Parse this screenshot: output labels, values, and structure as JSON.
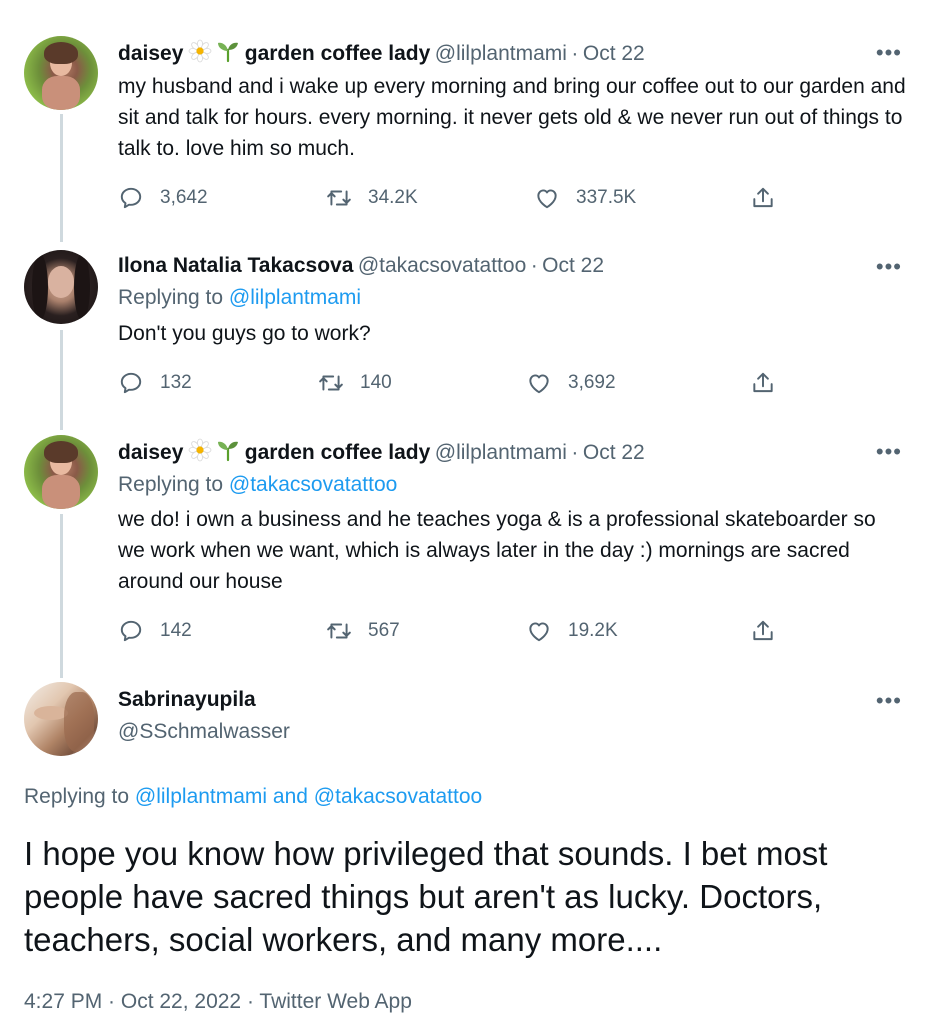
{
  "tweets": [
    {
      "display_name": "daisey",
      "name_suffix": "garden coffee lady",
      "handle": "@lilplantmami",
      "separator": "·",
      "date": "Oct 22",
      "text": "my husband and i wake up every morning and bring our coffee out to our garden and sit and talk for hours. every morning. it never gets old & we never run out of things to talk to. love him so much.",
      "replies": "3,642",
      "retweets": "34.2K",
      "likes": "337.5K"
    },
    {
      "display_name": "Ilona Natalia Takacsova",
      "handle": "@takacsovatattoo",
      "separator": "·",
      "date": "Oct 22",
      "replying_label": "Replying to",
      "replying_to": "@lilplantmami",
      "text": "Don't you guys go to work?",
      "replies": "132",
      "retweets": "140",
      "likes": "3,692"
    },
    {
      "display_name": "daisey",
      "name_suffix": "garden coffee lady",
      "handle": "@lilplantmami",
      "separator": "·",
      "date": "Oct 22",
      "replying_label": "Replying to",
      "replying_to": "@takacsovatattoo",
      "text": "we do! i own a business and he teaches yoga & is a professional skateboarder so we work when we want, which is always later in the day :) mornings are sacred around our house",
      "replies": "142",
      "retweets": "567",
      "likes": "19.2K"
    }
  ],
  "main_tweet": {
    "display_name": "Sabrinayupila",
    "handle": "@SSchmalwasser",
    "replying_label": "Replying to",
    "replying_to": "@lilplantmami and @takacsovatattoo",
    "text": "I hope you know how privileged that sounds. I bet most people have sacred things but aren't as lucky. Doctors, teachers, social workers, and many more....",
    "meta": "4:27 PM · Oct 22, 2022 · Twitter Web App"
  },
  "more_label": "•••",
  "icons": {
    "reply": "reply-icon",
    "retweet": "retweet-icon",
    "like": "heart-icon",
    "share": "share-icon",
    "flower": "daisy-emoji-icon",
    "seedling": "seedling-emoji-icon"
  },
  "colors": {
    "link": "#1d9bf0",
    "secondary_text": "#536471",
    "thread_line": "#cfd9de"
  }
}
